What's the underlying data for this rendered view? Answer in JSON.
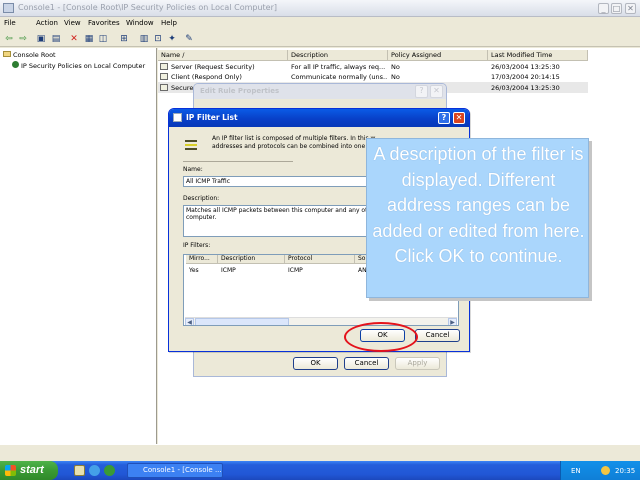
{
  "window": {
    "title": "Console1 - [Console Root\\IP Security Policies on Local Computer]",
    "min_glyph": "_",
    "max_glyph": "□",
    "close_glyph": "✕"
  },
  "menu": [
    "File",
    "Action",
    "View",
    "Favorites",
    "Window",
    "Help"
  ],
  "toolbar_icons": [
    "back-arrow-icon",
    "forward-arrow-icon",
    "up-folder-icon",
    "show-tree-icon",
    "delete-icon",
    "properties-icon",
    "refresh-icon",
    "export-list-icon",
    "help-icon",
    "manage-filters-icon",
    "add-policy-icon",
    "wizard-icon"
  ],
  "tree": {
    "root": "Console Root",
    "child": "IP Security Policies on Local Computer"
  },
  "list": {
    "columns": [
      "Name  /",
      "Description",
      "Policy Assigned",
      "Last Modified Time"
    ],
    "rows": [
      [
        "Server (Request Security)",
        "For all IP traffic, always req...",
        "No",
        "26/03/2004 13:25:30"
      ],
      [
        "Client (Respond Only)",
        "Communicate normally (uns...",
        "No",
        "17/03/2004 20:14:15"
      ],
      [
        "Secure",
        "",
        "",
        "26/03/2004 13:25:30"
      ]
    ]
  },
  "bg_dialog": {
    "title": "Edit Rule Properties",
    "ok": "OK",
    "cancel": "Cancel",
    "apply": "Apply"
  },
  "ip_filter_dialog": {
    "title": "IP Filter List",
    "intro_line1": "An IP filter list is composed of multiple filters. In this w",
    "intro_line2": "addresses and protocols can be combined into one",
    "name_label": "Name:",
    "name_value": "All ICMP Traffic",
    "description_label": "Description:",
    "description_line1": "Matches all ICMP packets between this computer and any ot",
    "description_line2": "computer.",
    "filters_label": "IP Filters:",
    "filter_columns": [
      "Mirro...",
      "Description",
      "Protocol",
      "So"
    ],
    "filter_rows": [
      [
        "Yes",
        "ICMP",
        "ICMP",
        "AN"
      ]
    ],
    "ok": "OK",
    "cancel": "Cancel",
    "help_glyph": "?",
    "close_glyph": "✕"
  },
  "callout": {
    "text": "A description of the filter is displayed. Different address ranges can be added or edited from here. Click OK to continue."
  },
  "taskbar": {
    "start": "start",
    "task": "Console1 - [Console ...",
    "language": "EN",
    "clock": "20:35"
  },
  "colors": {
    "xp_blue": "#0a5be6",
    "callout_bg": "#aad6fc",
    "highlight_red": "#e4121b"
  }
}
